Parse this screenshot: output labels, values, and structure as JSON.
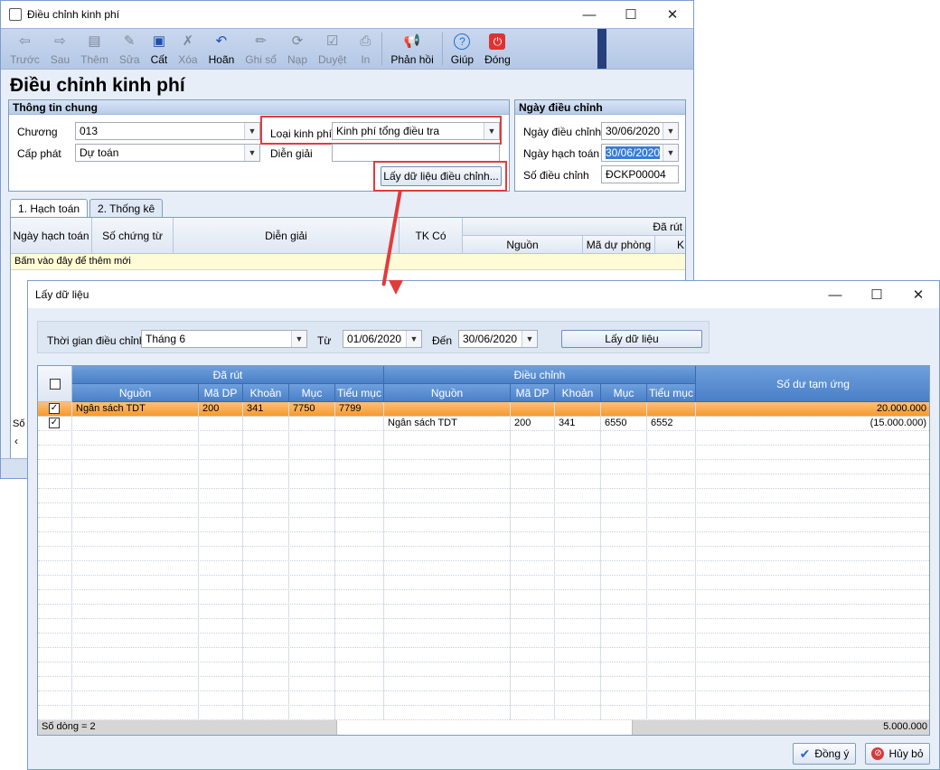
{
  "main": {
    "window_title": "Điều chỉnh kinh phí",
    "page_title": "Điều chỉnh kinh phí",
    "toolbar": [
      {
        "label": "Trước",
        "icon": "arrow-left-icon",
        "enabled": false
      },
      {
        "label": "Sau",
        "icon": "arrow-right-icon",
        "enabled": false
      },
      {
        "label": "Thêm",
        "icon": "add-doc-icon",
        "enabled": false
      },
      {
        "label": "Sửa",
        "icon": "edit-doc-icon",
        "enabled": false
      },
      {
        "label": "Cất",
        "icon": "save-icon",
        "enabled": true
      },
      {
        "label": "Xóa",
        "icon": "delete-doc-icon",
        "enabled": false
      },
      {
        "label": "Hoãn",
        "icon": "undo-icon",
        "enabled": true
      },
      {
        "label": "Ghi sổ",
        "icon": "pencil-icon",
        "enabled": false
      },
      {
        "label": "Nạp",
        "icon": "reload-icon",
        "enabled": false
      },
      {
        "label": "Duyệt",
        "icon": "approve-icon",
        "enabled": false
      },
      {
        "label": "In",
        "icon": "print-icon",
        "enabled": false
      },
      {
        "label": "Phản hồi",
        "icon": "megaphone-icon",
        "enabled": true
      },
      {
        "label": "Giúp",
        "icon": "help-icon",
        "enabled": true
      },
      {
        "label": "Đóng",
        "icon": "power-icon",
        "enabled": true
      }
    ],
    "general": {
      "header": "Thông tin chung",
      "chuong_label": "Chương",
      "chuong_value": "013",
      "cap_phat_label": "Cấp phát",
      "cap_phat_value": "Dự toán",
      "loai_kp_label": "Loại kinh phí",
      "loai_kp_value": "Kinh phí tổng điều tra",
      "dien_giai_label": "Diễn giải",
      "dien_giai_value": "",
      "fetch_button": "Lấy dữ liệu điều chỉnh..."
    },
    "dates": {
      "header": "Ngày điều chỉnh",
      "ngay_dc_label": "Ngày điều chỉnh",
      "ngay_dc_value": "30/06/2020",
      "ngay_ht_label": "Ngày hạch toán",
      "ngay_ht_value": "30/06/2020",
      "so_dc_label": "Số điều chỉnh",
      "so_dc_value": "ĐCKP00004"
    },
    "tabs": [
      "1. Hạch toán",
      "2. Thống kê"
    ],
    "grid_headers": {
      "ngay_ht": "Ngày hạch toán",
      "so_ct": "Số chứng từ",
      "dien_giai": "Diễn giải",
      "tk_co": "TK Có",
      "da_rut": "Đã rút",
      "nguon": "Nguồn",
      "ma_du_phong": "Mã dự phòng",
      "k": "K"
    },
    "add_row_text": "Bấm vào đây để thêm mới",
    "status_fragment": "Số"
  },
  "dialog": {
    "title": "Lấy dữ liệu",
    "period_label": "Thời gian điều chỉnh",
    "period_value": "Tháng 6",
    "from_label": "Từ",
    "from_value": "01/06/2020",
    "to_label": "Đến",
    "to_value": "30/06/2020",
    "fetch_button": "Lấy dữ liệu",
    "group_headers": {
      "da_rut": "Đã rút",
      "dieu_chinh": "Điều chỉnh",
      "so_du": "Số dư tạm ứng"
    },
    "columns": [
      "Nguồn",
      "Mã DP",
      "Khoản",
      "Mục",
      "Tiểu mục",
      "Nguồn",
      "Mã DP",
      "Khoản",
      "Mục",
      "Tiểu mục"
    ],
    "rows": [
      {
        "checked": true,
        "selected": true,
        "cells": [
          "Ngân sách  TDT",
          "200",
          "341",
          "7750",
          "7799",
          "",
          "",
          "",
          "",
          ""
        ],
        "so_du": "20.000.000"
      },
      {
        "checked": true,
        "selected": false,
        "cells": [
          "",
          "",
          "",
          "",
          "",
          "Ngân sách  TDT",
          "200",
          "341",
          "6550",
          "6552"
        ],
        "so_du": "(15.000.000)"
      }
    ],
    "footer_count": "Số dòng = 2",
    "footer_total": "5.000.000",
    "ok_button": "Đồng ý",
    "cancel_button": "Hủy bỏ"
  },
  "colors": {
    "highlight": "#e03c3c",
    "selected_row": "#f7a53c",
    "header_blue": "#4a7fc8"
  }
}
